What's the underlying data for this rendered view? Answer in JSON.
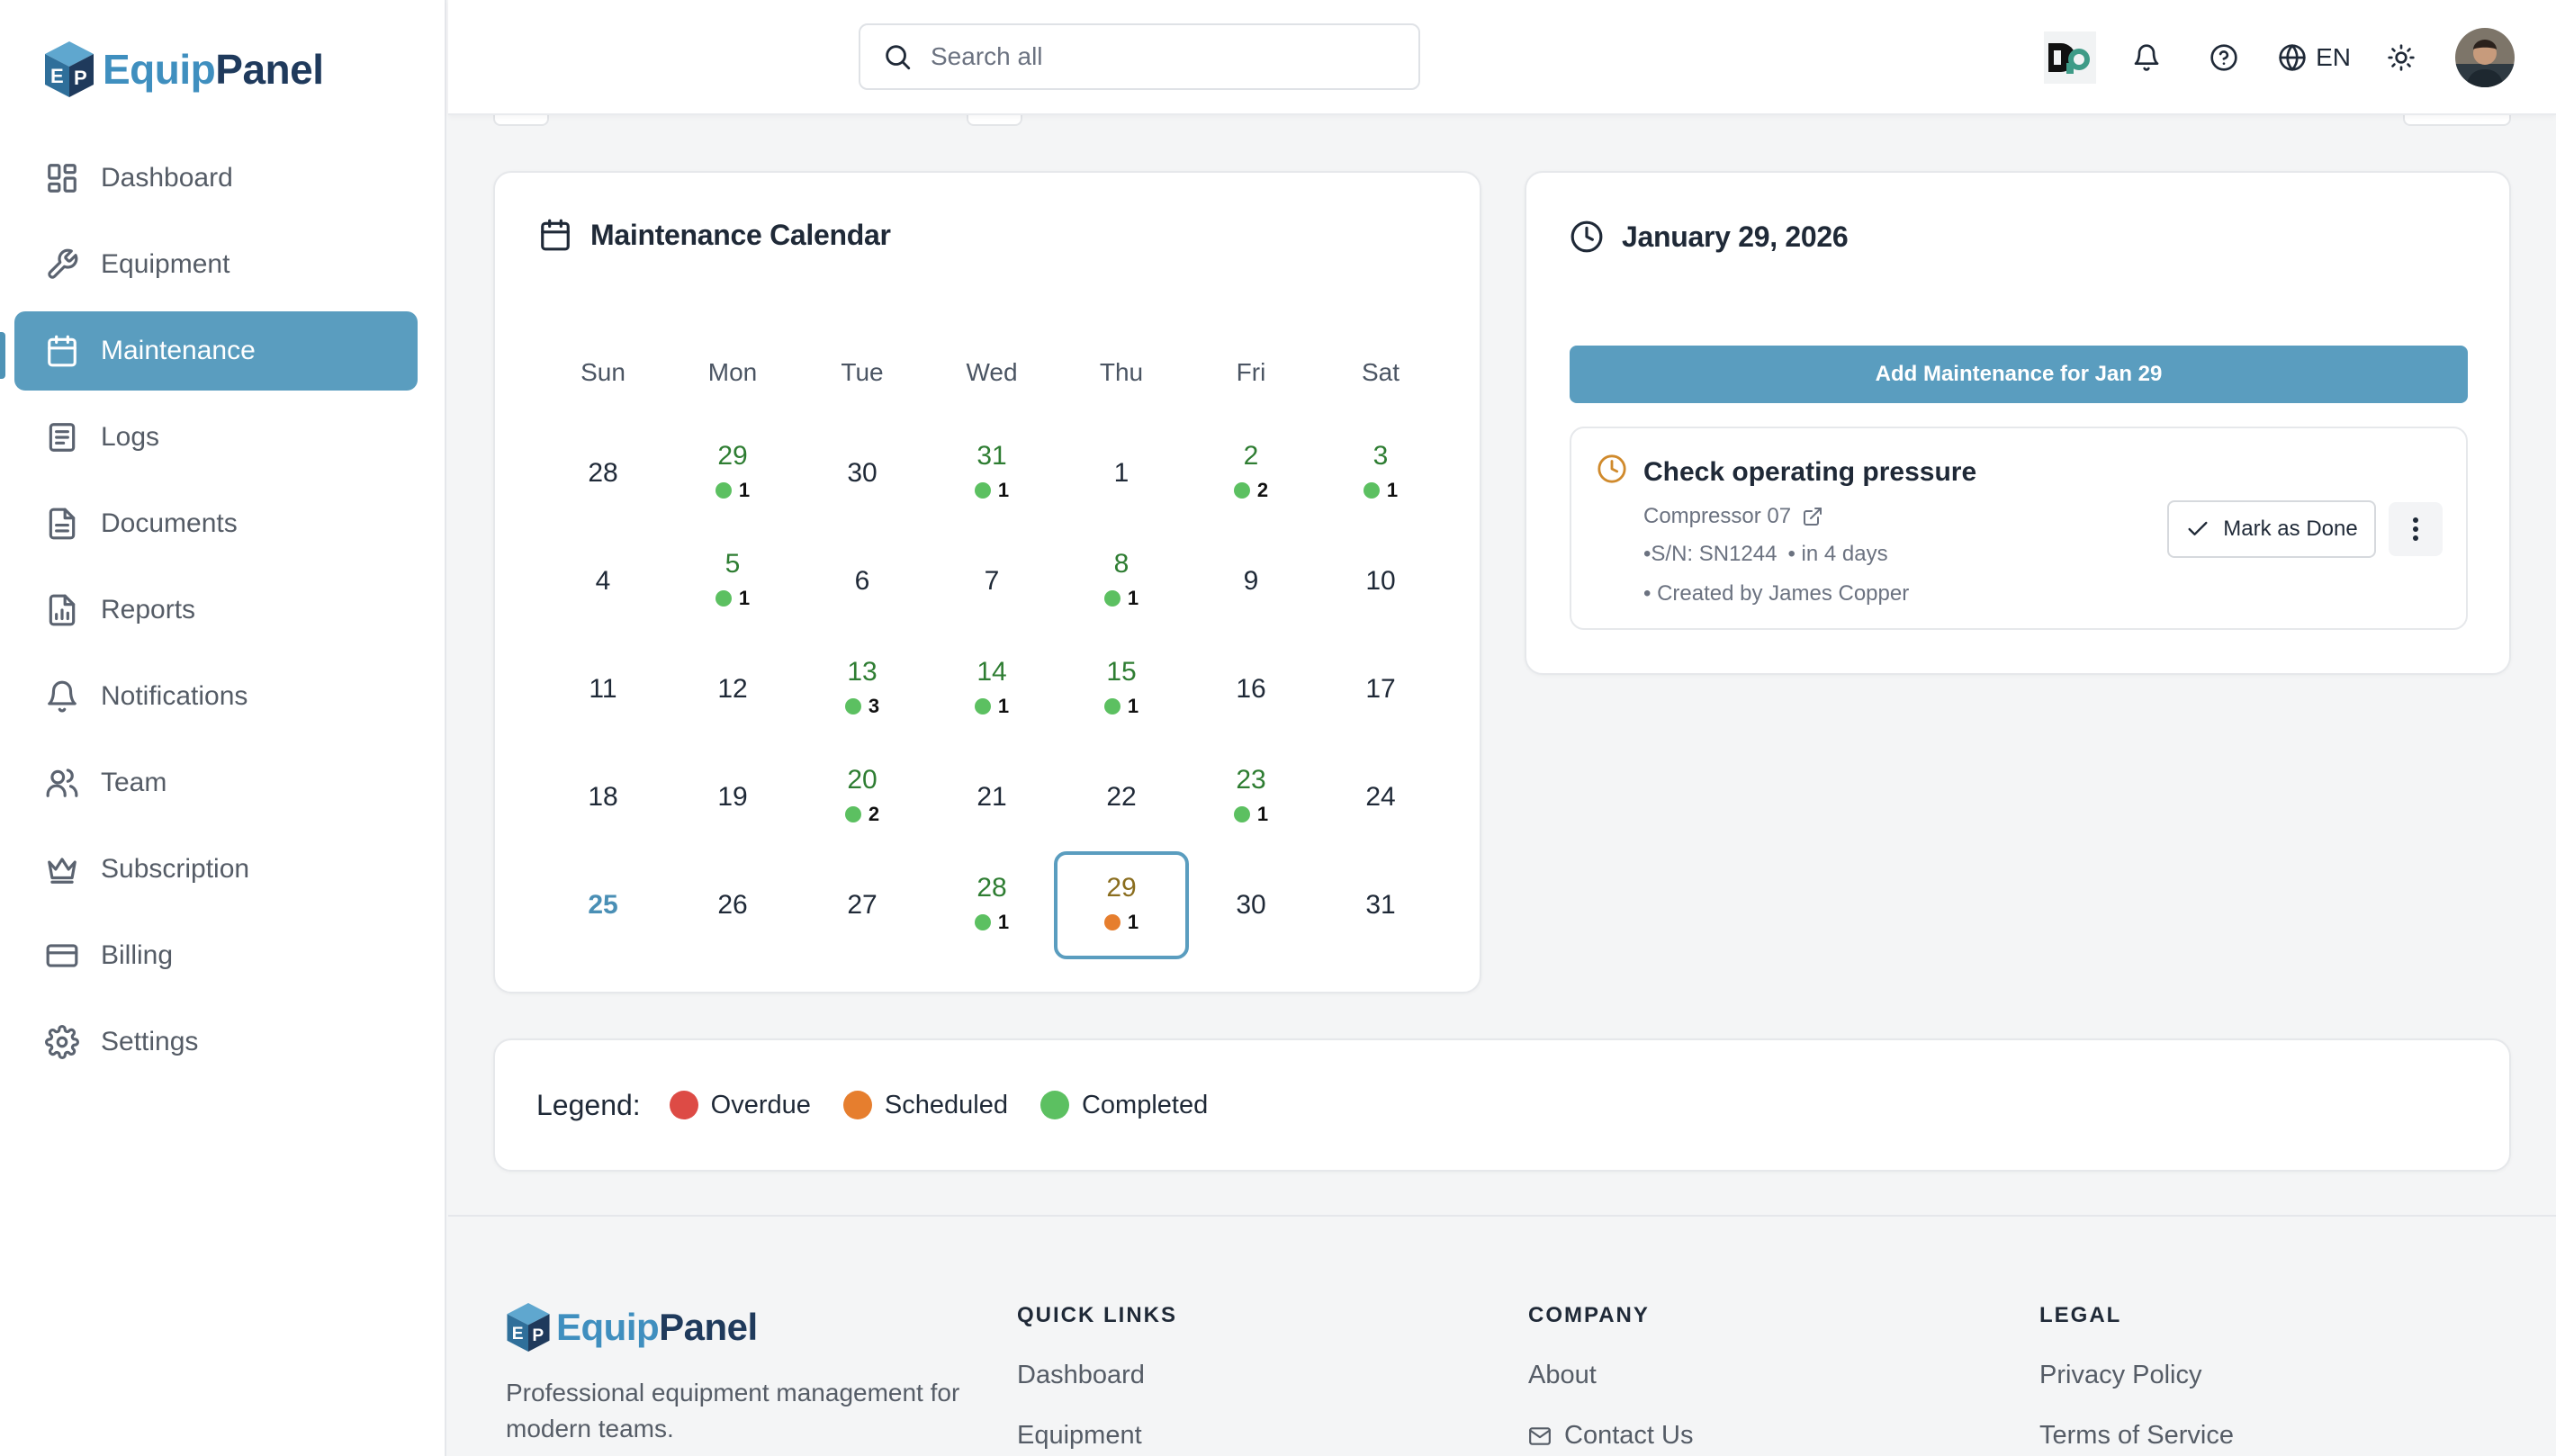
{
  "brand": {
    "name_part1": "Equip",
    "name_part2": "Panel"
  },
  "sidebar": {
    "items": [
      {
        "label": "Dashboard",
        "icon": "dashboard-icon"
      },
      {
        "label": "Equipment",
        "icon": "wrench-icon"
      },
      {
        "label": "Maintenance",
        "icon": "calendar-icon",
        "active": true
      },
      {
        "label": "Logs",
        "icon": "log-icon"
      },
      {
        "label": "Documents",
        "icon": "document-icon"
      },
      {
        "label": "Reports",
        "icon": "report-icon"
      },
      {
        "label": "Notifications",
        "icon": "bell-icon"
      },
      {
        "label": "Team",
        "icon": "team-icon"
      },
      {
        "label": "Subscription",
        "icon": "crown-icon"
      },
      {
        "label": "Billing",
        "icon": "credit-card-icon"
      },
      {
        "label": "Settings",
        "icon": "gear-icon"
      }
    ]
  },
  "header": {
    "search_placeholder": "Search all",
    "language": "EN"
  },
  "calendar": {
    "title": "Maintenance Calendar",
    "weekdays": [
      "Sun",
      "Mon",
      "Tue",
      "Wed",
      "Thu",
      "Fri",
      "Sat"
    ],
    "weeks": [
      [
        {
          "d": "28"
        },
        {
          "d": "29",
          "c": "1"
        },
        {
          "d": "30"
        },
        {
          "d": "31",
          "c": "1"
        },
        {
          "d": "1"
        },
        {
          "d": "2",
          "c": "2"
        },
        {
          "d": "3",
          "c": "1"
        }
      ],
      [
        {
          "d": "4"
        },
        {
          "d": "5",
          "c": "1"
        },
        {
          "d": "6"
        },
        {
          "d": "7"
        },
        {
          "d": "8",
          "c": "1"
        },
        {
          "d": "9"
        },
        {
          "d": "10"
        }
      ],
      [
        {
          "d": "11"
        },
        {
          "d": "12"
        },
        {
          "d": "13",
          "c": "3"
        },
        {
          "d": "14",
          "c": "1"
        },
        {
          "d": "15",
          "c": "1"
        },
        {
          "d": "16"
        },
        {
          "d": "17"
        }
      ],
      [
        {
          "d": "18"
        },
        {
          "d": "19"
        },
        {
          "d": "20",
          "c": "2"
        },
        {
          "d": "21"
        },
        {
          "d": "22"
        },
        {
          "d": "23",
          "c": "1"
        },
        {
          "d": "24"
        }
      ],
      [
        {
          "d": "25",
          "today": true
        },
        {
          "d": "26"
        },
        {
          "d": "27"
        },
        {
          "d": "28",
          "c": "1"
        },
        {
          "d": "29",
          "c": "1",
          "status": "scheduled",
          "selected": true
        },
        {
          "d": "30"
        },
        {
          "d": "31"
        }
      ]
    ]
  },
  "details": {
    "date_title": "January 29, 2026",
    "add_button": "Add Maintenance for Jan 29",
    "task": {
      "title": "Check operating pressure",
      "equipment": "Compressor 07",
      "serial": "•S/N: SN1244",
      "due": "• in 4 days",
      "created": "• Created by James Copper",
      "done_button": "Mark as Done"
    }
  },
  "legend": {
    "label": "Legend:",
    "items": [
      {
        "label": "Overdue",
        "color": "#dd4b45"
      },
      {
        "label": "Scheduled",
        "color": "#e67e2e"
      },
      {
        "label": "Completed",
        "color": "#5cc061"
      }
    ]
  },
  "footer": {
    "description": "Professional equipment management for modern teams.",
    "quick_links": {
      "heading": "QUICK LINKS",
      "links": [
        "Dashboard",
        "Equipment"
      ]
    },
    "company": {
      "heading": "COMPANY",
      "links": [
        "About",
        "Contact Us"
      ]
    },
    "legal": {
      "heading": "LEGAL",
      "links": [
        "Privacy Policy",
        "Terms of Service"
      ]
    }
  }
}
